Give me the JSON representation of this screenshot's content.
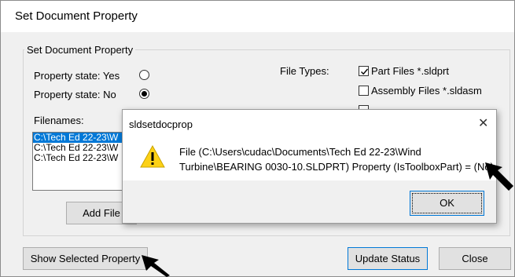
{
  "window": {
    "title": "Set Document Property"
  },
  "group": {
    "legend": "Set Document Property",
    "property_yes_label": "Property state: Yes",
    "property_no_label": "Property state: No",
    "file_types_label": "File Types:",
    "filenames_label": "Filenames:",
    "file_types": [
      {
        "label": "Part Files *.sldprt",
        "checked": true
      },
      {
        "label": "Assembly Files *.sldasm",
        "checked": false
      }
    ],
    "selected_state": "No"
  },
  "filenames": [
    "C:\\Tech Ed 22-23\\W",
    "C:\\Tech Ed 22-23\\W",
    "C:\\Tech Ed 22-23\\W"
  ],
  "buttons": {
    "add_files": "Add File",
    "show_selected": "Show Selected Property",
    "update_status": "Update Status",
    "close": "Close"
  },
  "popup": {
    "title": "sldsetdocprop",
    "message_line1": "File (C:\\Users\\cudac\\Documents\\Tech Ed 22-23\\Wind",
    "message_line2": "Turbine\\BEARING 0030-10.SLDPRT) Property (IsToolboxPart) = (No)",
    "ok_label": "OK",
    "icon": "warning-icon"
  },
  "colors": {
    "selection": "#0078d7",
    "warning": "#fcd116"
  }
}
